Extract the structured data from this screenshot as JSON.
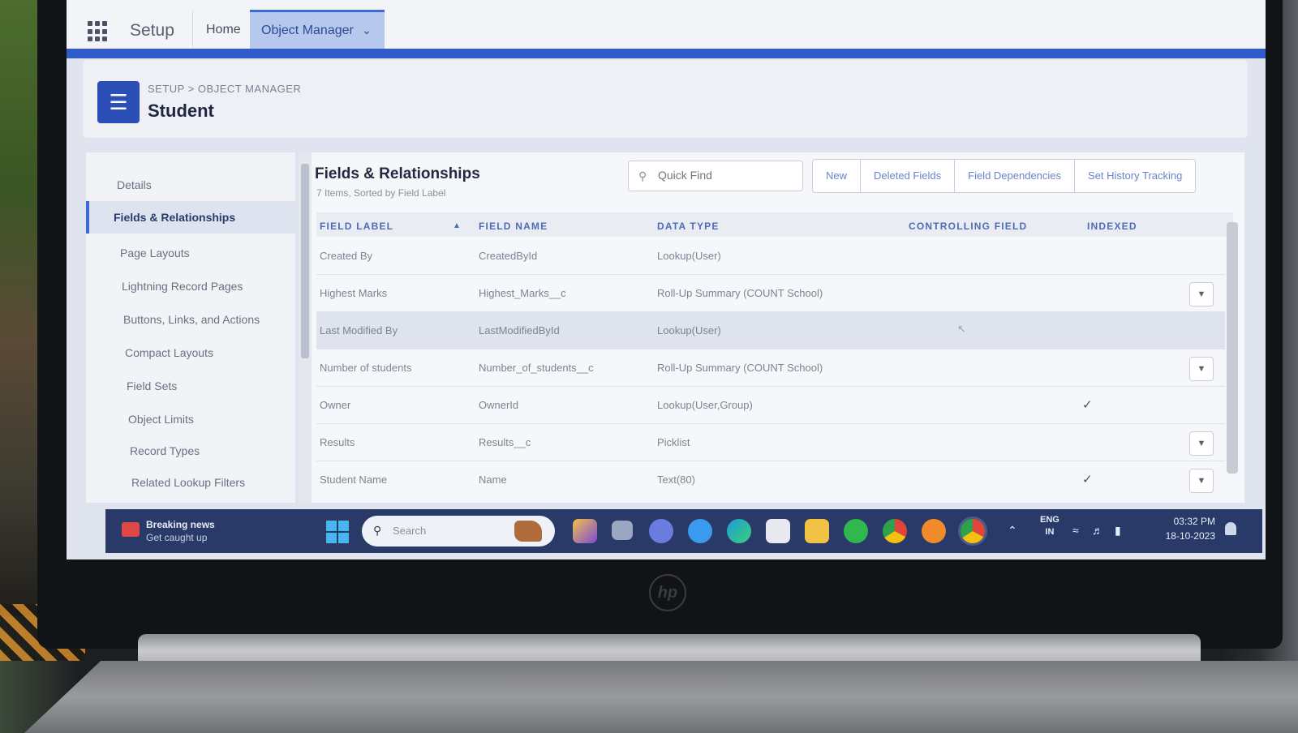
{
  "nav": {
    "app_name": "Setup",
    "tabs": [
      {
        "label": "Home"
      },
      {
        "label": "Object Manager"
      }
    ]
  },
  "header": {
    "breadcrumb": "SETUP > OBJECT MANAGER",
    "title": "Student"
  },
  "sidebar": {
    "items": [
      {
        "label": "Details"
      },
      {
        "label": "Fields & Relationships"
      },
      {
        "label": "Page Layouts"
      },
      {
        "label": "Lightning Record Pages"
      },
      {
        "label": "Buttons, Links, and Actions"
      },
      {
        "label": "Compact Layouts"
      },
      {
        "label": "Field Sets"
      },
      {
        "label": "Object Limits"
      },
      {
        "label": "Record Types"
      },
      {
        "label": "Related Lookup Filters"
      }
    ]
  },
  "main": {
    "title": "Fields & Relationships",
    "subtitle": "7 Items, Sorted by Field Label",
    "quick_find_placeholder": "Quick Find",
    "buttons": [
      "New",
      "Deleted Fields",
      "Field Dependencies",
      "Set History Tracking"
    ],
    "columns": [
      "FIELD LABEL",
      "FIELD NAME",
      "DATA TYPE",
      "CONTROLLING FIELD",
      "INDEXED"
    ],
    "rows": [
      {
        "label": "Created By",
        "name": "CreatedById",
        "type": "Lookup(User)",
        "indexed": "",
        "menu": ""
      },
      {
        "label": "Highest Marks",
        "name": "Highest_Marks__c",
        "type": "Roll-Up Summary (COUNT School)",
        "indexed": "",
        "menu": "▼"
      },
      {
        "label": "Last Modified By",
        "name": "LastModifiedById",
        "type": "Lookup(User)",
        "indexed": "",
        "menu": ""
      },
      {
        "label": "Number of students",
        "name": "Number_of_students__c",
        "type": "Roll-Up Summary (COUNT School)",
        "indexed": "",
        "menu": "▼"
      },
      {
        "label": "Owner",
        "name": "OwnerId",
        "type": "Lookup(User,Group)",
        "indexed": "✓",
        "menu": ""
      },
      {
        "label": "Results",
        "name": "Results__c",
        "type": "Picklist",
        "indexed": "",
        "menu": "▼"
      },
      {
        "label": "Student Name",
        "name": "Name",
        "type": "Text(80)",
        "indexed": "✓",
        "menu": "▼"
      }
    ]
  },
  "taskbar": {
    "news_title": "Breaking news",
    "news_sub": "Get caught up",
    "search_placeholder": "Search",
    "lang_1": "ENG",
    "lang_2": "IN",
    "time": "03:32 PM",
    "date": "18-10-2023"
  },
  "laptop_brand": "hp",
  "colors": {
    "accent": "#2f5cc9",
    "icon_bg": "#2b4fb6",
    "taskbar": "#2a3a68"
  }
}
